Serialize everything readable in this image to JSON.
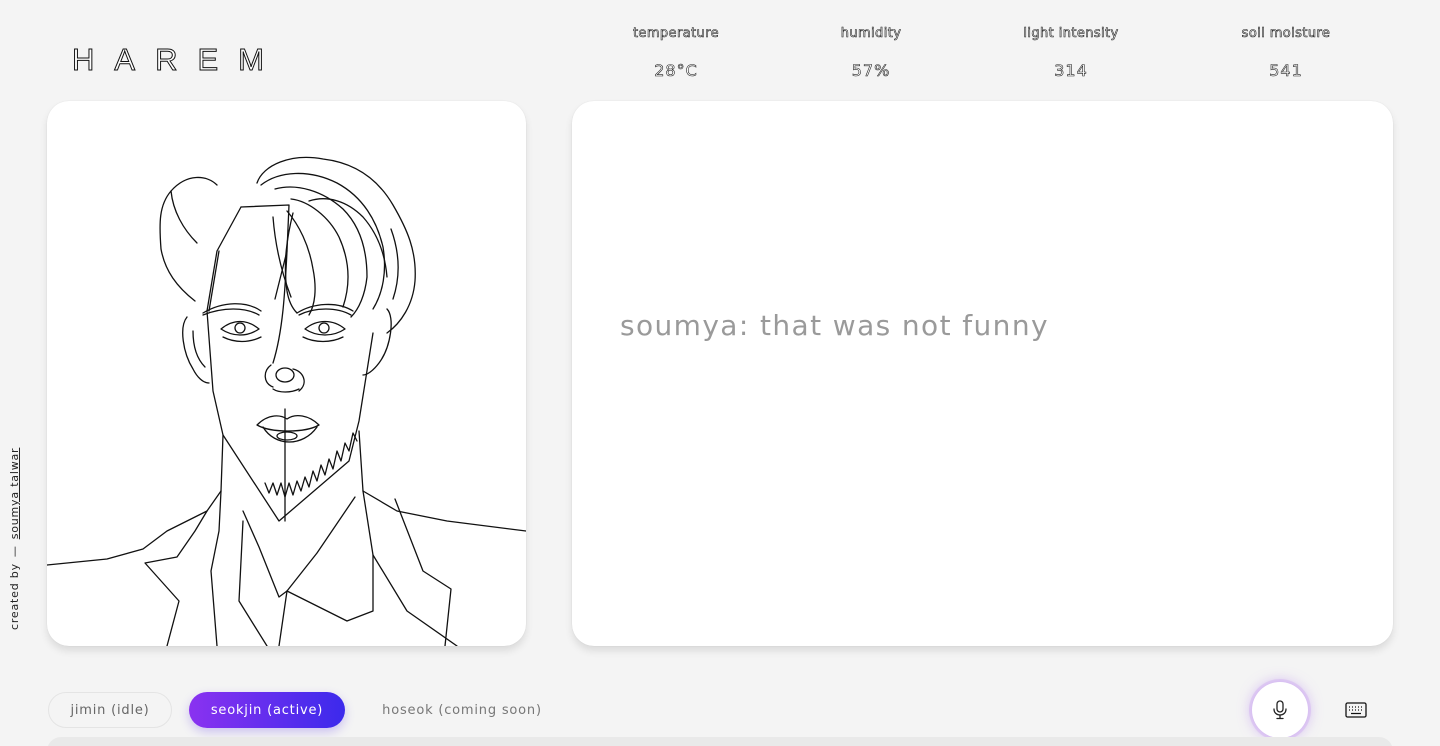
{
  "logo": {
    "text": "HAREM"
  },
  "sensors": [
    {
      "label": "temperature",
      "value": "28°C"
    },
    {
      "label": "humidity",
      "value": "57%"
    },
    {
      "label": "light intensity",
      "value": "314"
    },
    {
      "label": "soil moisture",
      "value": "541"
    }
  ],
  "chat": {
    "message": "soumya: that was not funny"
  },
  "credit": {
    "prefix": "created by",
    "dash": "—",
    "author": "soumya talwar"
  },
  "characters": [
    {
      "label": "jimin (idle)"
    },
    {
      "label": "seokjin (active)"
    },
    {
      "label": "hoseok (coming soon)"
    }
  ],
  "controls": {
    "mic_icon": "mic-icon",
    "keyboard_icon": "keyboard-icon"
  },
  "colors": {
    "accent_start": "#8a32f0",
    "accent_end": "#3c2aec",
    "chat_text": "#9a9a9a"
  }
}
